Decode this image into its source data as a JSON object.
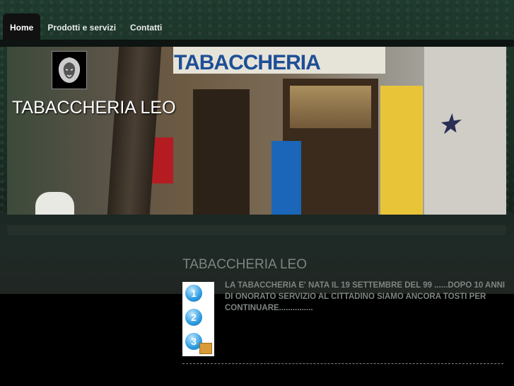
{
  "nav": {
    "items": [
      {
        "label": "Home",
        "active": true
      },
      {
        "label": "Prodotti e servizi",
        "active": false
      },
      {
        "label": "Contatti",
        "active": false
      }
    ]
  },
  "header": {
    "site_title": "TABACCHERIA LEO",
    "banner_sign": "TABACCHERIA"
  },
  "main": {
    "title": "TABACCHERIA LEO",
    "body": "LA TABACCHERIA E' NATA IL 19 SETTEMBRE DEL 99 ......DOPO 10 ANNI DI ONORATO SERVIZIO AL CITTADINO SIAMO ANCORA TOSTI PER CONTINUARE...............",
    "steps": [
      "1",
      "2",
      "3"
    ]
  },
  "colors": {
    "background_top": "#1f3a2e",
    "content_text": "#7d8580",
    "nav_active_bg": "#111111"
  }
}
